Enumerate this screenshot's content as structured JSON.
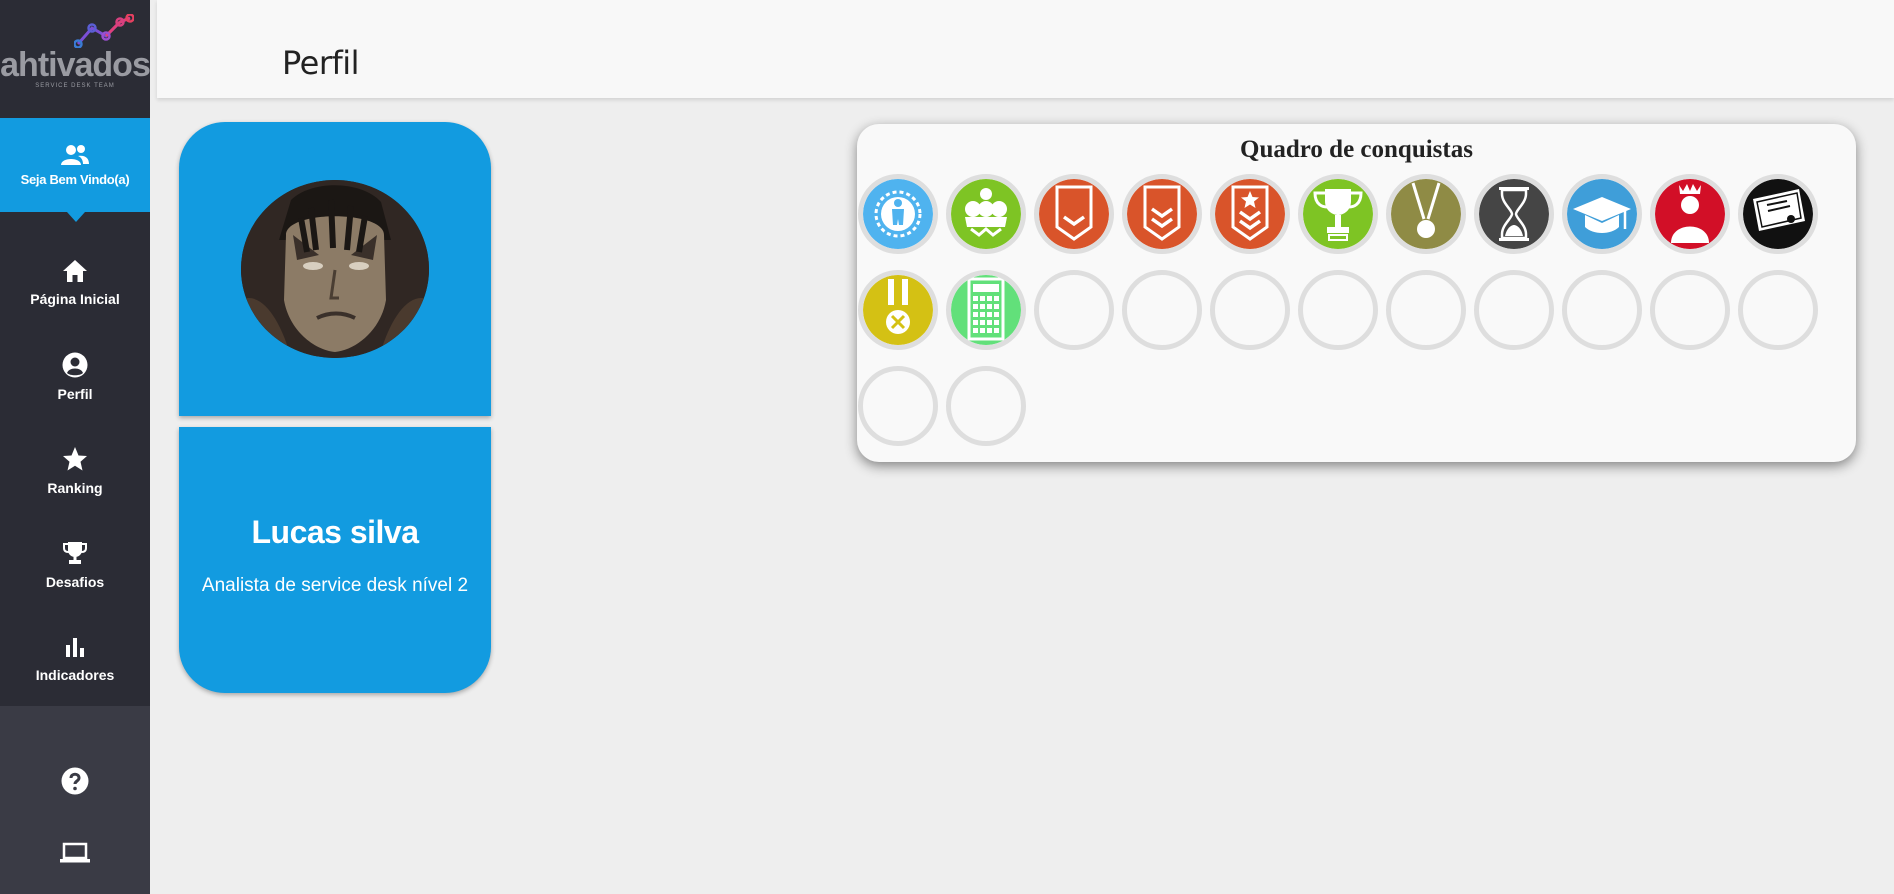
{
  "logo": {
    "text": "ahtivados",
    "subtitle": "SERVICE DESK TEAM"
  },
  "sidebar": {
    "welcome": {
      "label": "Seja Bem Vindo(a)",
      "icon": "users-icon"
    },
    "items": [
      {
        "label": "Página Inicial",
        "icon": "home-icon"
      },
      {
        "label": "Perfil",
        "icon": "user-circle-icon"
      },
      {
        "label": "Ranking",
        "icon": "star-icon"
      },
      {
        "label": "Desafios",
        "icon": "trophy-icon"
      },
      {
        "label": "Indicadores",
        "icon": "bar-chart-icon"
      }
    ],
    "bottom": [
      {
        "icon": "help-icon"
      },
      {
        "icon": "laptop-icon"
      }
    ]
  },
  "header": {
    "title": "Perfil"
  },
  "profile": {
    "name": "Lucas silva",
    "role": "Analista de service desk nível 2"
  },
  "achievements": {
    "title": "Quadro de conquistas",
    "earned": [
      {
        "icon": "person-sun-icon",
        "color": "#4fb3ef"
      },
      {
        "icon": "crowd-icon",
        "color": "#7ec424"
      },
      {
        "icon": "rank-chevron-1-icon",
        "color": "#d9542a"
      },
      {
        "icon": "rank-chevron-2-icon",
        "color": "#d9542a"
      },
      {
        "icon": "rank-star-icon",
        "color": "#d9542a"
      },
      {
        "icon": "trophy-cup-icon",
        "color": "#7ec424"
      },
      {
        "icon": "medal-icon",
        "color": "#8f8b45"
      },
      {
        "icon": "hourglass-icon",
        "color": "#454545"
      },
      {
        "icon": "graduation-cap-icon",
        "color": "#3f9ed9"
      },
      {
        "icon": "king-icon",
        "color": "#d20f27"
      },
      {
        "icon": "certificate-icon",
        "color": "#111111"
      },
      {
        "icon": "medal-ribbon-icon",
        "color": "#d4c114"
      },
      {
        "icon": "calculator-icon",
        "color": "#62e07a"
      }
    ],
    "locked_count": 11
  },
  "colors": {
    "sidebar": "#2b2c35",
    "accent": "#129be0",
    "background": "#eeeeee"
  }
}
